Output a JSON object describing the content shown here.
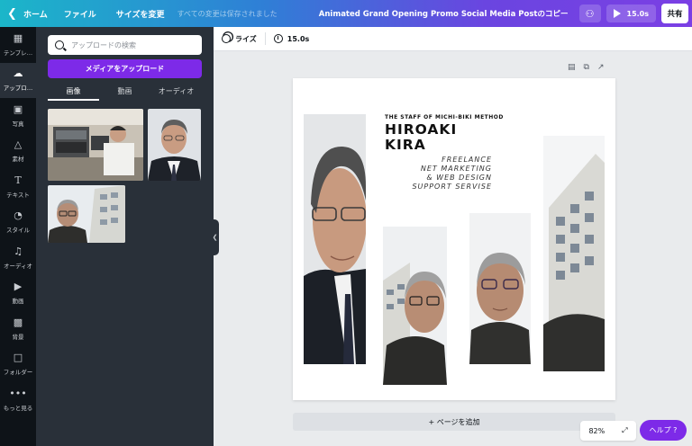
{
  "topbar": {
    "home": "ホーム",
    "file": "ファイル",
    "resize": "サイズを変更",
    "saved_status": "すべての変更は保存されました",
    "doc_title": "Animated Grand Opening Promo Social Media Postのコピー",
    "duration": "15.0s",
    "share": "共有"
  },
  "rail": [
    {
      "label": "テンプレ…",
      "icon": "template-icon"
    },
    {
      "label": "アップロ…",
      "icon": "upload-cloud-icon"
    },
    {
      "label": "写真",
      "icon": "photo-icon"
    },
    {
      "label": "素材",
      "icon": "elements-icon"
    },
    {
      "label": "テキスト",
      "icon": "text-icon"
    },
    {
      "label": "スタイル",
      "icon": "palette-icon"
    },
    {
      "label": "オーディオ",
      "icon": "music-icon"
    },
    {
      "label": "動画",
      "icon": "video-icon"
    },
    {
      "label": "背景",
      "icon": "background-icon"
    },
    {
      "label": "フォルダー",
      "icon": "folder-icon"
    },
    {
      "label": "もっと見る",
      "icon": "more-icon"
    }
  ],
  "panel": {
    "search_placeholder": "アップロードの検索",
    "upload_button": "メディアをアップロード",
    "tabs": [
      "画像",
      "動画",
      "オーディオ"
    ]
  },
  "editor": {
    "animate": "ライズ",
    "duration": "15.0s",
    "add_page": "+ ページを追加",
    "zoom": "82%",
    "help": "ヘルプ ?"
  },
  "design": {
    "staff": "THE STAFF OF MICHI-BIKI METHOD",
    "name_line1": "HIROAKI",
    "name_line2": "KIRA",
    "sub_lines": [
      "FREELANCE",
      "NET MARKETING",
      "& WEB DESIGN",
      "SUPPORT SERVISE"
    ]
  },
  "colors": {
    "accent": "#7d2ae8",
    "panel": "#293039",
    "rail": "#0e1318"
  }
}
